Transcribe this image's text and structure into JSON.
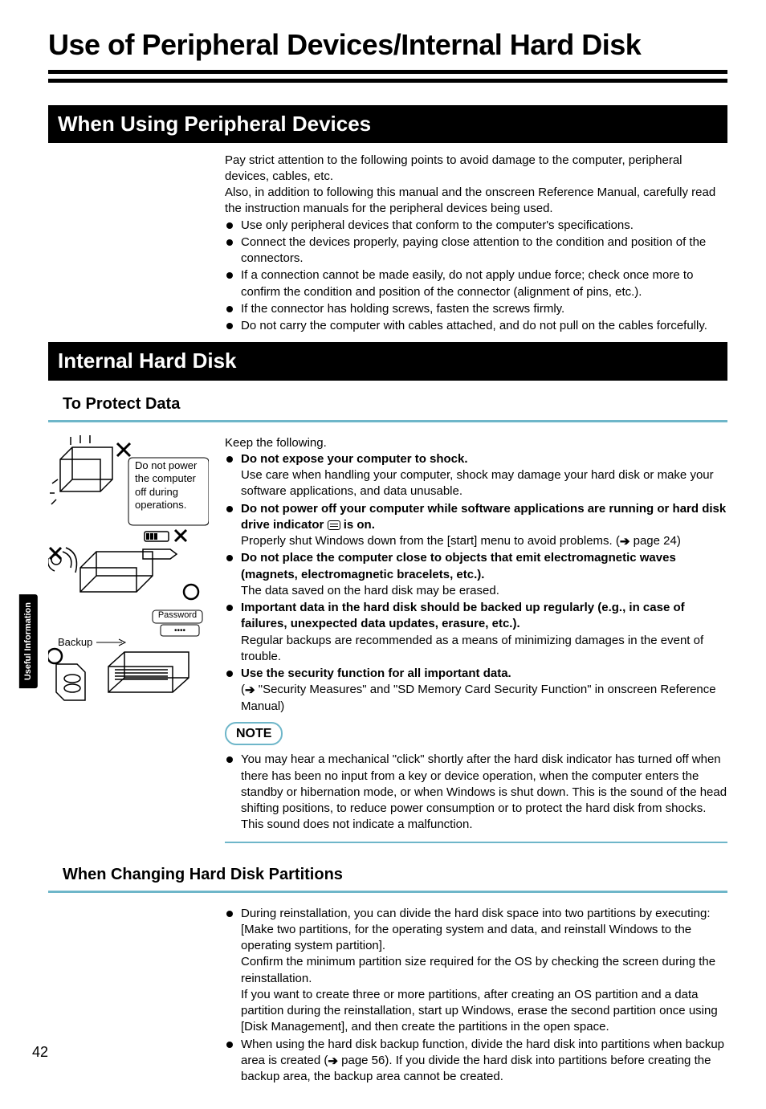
{
  "title": "Use of Peripheral Devices/Internal Hard Disk",
  "side_tab": "Useful Information",
  "page_number": "42",
  "section1": {
    "heading": "When Using Peripheral Devices",
    "intro1": "Pay strict attention to the following points to avoid damage to the computer, peripheral devices, cables, etc.",
    "intro2": "Also, in addition to following this manual and the onscreen Reference Manual, carefully read the instruction manuals for the peripheral devices being used.",
    "bullets": [
      "Use only peripheral devices that conform to the computer's specifications.",
      "Connect the devices properly, paying close attention to the condition and position of the connectors.",
      "If a connection cannot be made easily, do not apply undue force; check once more to confirm the condition and position of the connector (alignment of pins, etc.).",
      "If the connector has holding screws, fasten the screws firmly.",
      "Do not carry the computer with cables attached, and do not pull on the cables forcefully."
    ]
  },
  "section2": {
    "heading": "Internal Hard Disk",
    "sub1": {
      "heading": "To Protect Data",
      "figure": {
        "caption1": "Do not power the computer off during operations.",
        "caption2": "Password",
        "caption3": "Backup"
      },
      "intro": "Keep the following.",
      "items": [
        {
          "bold": "Do not expose your computer to shock.",
          "text": "Use care when handling your computer, shock may damage your hard disk or make your software applications, and data unusable."
        },
        {
          "bold_pre": "Do not power off your computer while software applications are running or hard disk drive indicator ",
          "bold_post": " is on.",
          "text_pre": "Properly shut Windows down from the [start] menu to avoid problems. (",
          "text_post": " page 24)"
        },
        {
          "bold": "Do not place the computer close to objects that emit electromagnetic waves (magnets, electromagnetic bracelets, etc.).",
          "text": "The data saved on the hard disk may be erased."
        },
        {
          "bold": "Important data in the hard disk should be backed up regularly (e.g., in case of failures, unexpected data updates, erasure, etc.).",
          "text": "Regular backups are recommended as a means of minimizing damages in the event of trouble."
        },
        {
          "bold": "Use the security function for all important data.",
          "text_pre": "(",
          "text_post": " \"Security Measures\" and \"SD Memory Card Security Function\" in onscreen Reference Manual)"
        }
      ],
      "note_label": "NOTE",
      "note_text": "You may hear a mechanical \"click\" shortly after the hard disk indicator has turned off when there has been no input from a key or device operation, when the computer enters the standby or hibernation mode, or when Windows is shut down. This is the sound of the head shifting positions, to reduce power consumption or to protect the hard disk from shocks. This sound does not indicate a malfunction."
    },
    "sub2": {
      "heading": "When Changing Hard Disk Partitions",
      "items": [
        {
          "p1": "During reinstallation, you can divide the hard disk space into two partitions by executing: [Make two partitions, for the operating system and data, and reinstall Windows to the operating system partition].",
          "p2": "Confirm the minimum partition size required for the OS by checking the screen during the reinstallation.",
          "p3": "If you want to create three or more partitions, after creating an OS partition and a data partition during the reinstallation, start up Windows, erase the second partition once using [Disk Management], and then create the partitions in the open space."
        },
        {
          "p1_pre": "When using the hard disk backup function, divide the hard disk into partitions when backup area is created (",
          "p1_post": " page 56). If you divide the hard disk into partitions before creating the backup area, the backup area cannot be created."
        }
      ]
    }
  }
}
